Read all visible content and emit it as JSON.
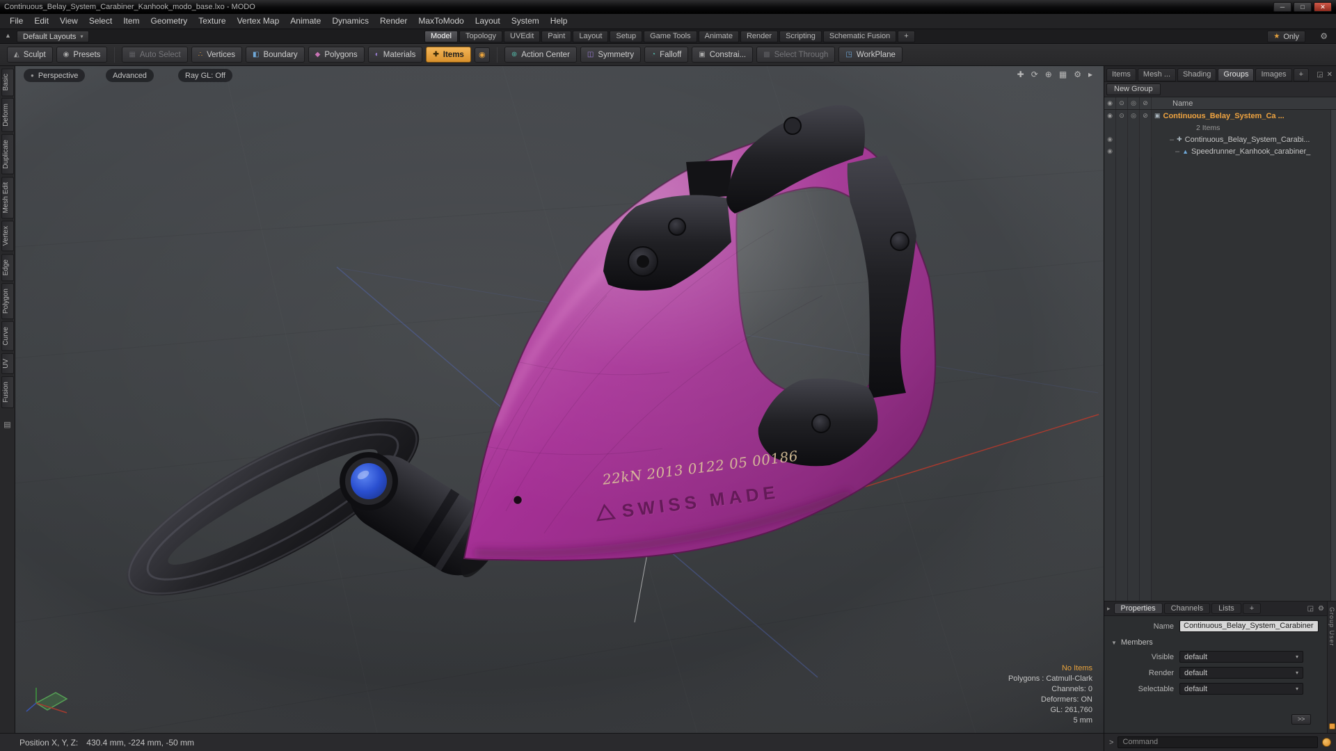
{
  "window": {
    "title": "Continuous_Belay_System_Carabiner_Kanhook_modo_base.lxo - MODO"
  },
  "icons": {
    "minimize": "─",
    "maximize": "□",
    "close": "✕",
    "layout_up": "▲",
    "dropdown": "▾",
    "star": "★",
    "gear": "⚙",
    "sculpt": "◭",
    "presets": "◉",
    "auto_select": "▦",
    "vertices": "∴",
    "boundary": "◧",
    "polygons": "◆",
    "materials": "◐",
    "items": "✚",
    "items_mode": "◉",
    "action_center": "⊕",
    "symmetry": "◫",
    "falloff": "◔",
    "constraints": "▣",
    "select_through": "▩",
    "workplane": "◳",
    "perspective": "●",
    "pan": "✚",
    "orbit": "⟳",
    "zoom": "⊕",
    "shade": "▦",
    "vp_gear": "⚙",
    "vp_arrow": "▸",
    "eye": "◉",
    "circle1": "⊙",
    "circle2": "◎",
    "circle3": "⊘",
    "group": "▣",
    "locator": "✚",
    "mesh": "▲",
    "caret_down": "▾",
    "caret_right": "▸",
    "tree_dash": "–",
    "panel_expand": "◲",
    "panel_close": "✕",
    "members_arrow": "▼",
    "palette": "▤"
  },
  "menu": {
    "items": [
      "File",
      "Edit",
      "View",
      "Select",
      "Item",
      "Geometry",
      "Texture",
      "Vertex Map",
      "Animate",
      "Dynamics",
      "Render",
      "MaxToModo",
      "Layout",
      "System",
      "Help"
    ]
  },
  "layout_bar": {
    "switcher": "Default Layouts",
    "tabs": [
      "Model",
      "Topology",
      "UVEdit",
      "Paint",
      "Layout",
      "Setup",
      "Game Tools",
      "Animate",
      "Render",
      "Scripting",
      "Schematic Fusion",
      "+"
    ],
    "only": "Only"
  },
  "toolbar": {
    "buttons": [
      {
        "label": "Sculpt"
      },
      {
        "label": "Presets"
      },
      {
        "label": "Auto Select"
      },
      {
        "label": "Vertices"
      },
      {
        "label": "Boundary"
      },
      {
        "label": "Polygons"
      },
      {
        "label": "Materials"
      },
      {
        "label": "Items"
      },
      {
        "label": "Action Center"
      },
      {
        "label": "Symmetry"
      },
      {
        "label": "Falloff"
      },
      {
        "label": "Constrai..."
      },
      {
        "label": "Select Through"
      },
      {
        "label": "WorkPlane"
      }
    ]
  },
  "left_tabs": {
    "items": [
      "Basic",
      "Deform",
      "Duplicate",
      "Mesh Edit",
      "Vertex",
      "Edge",
      "Polygon",
      "Curve",
      "UV",
      "Fusion"
    ]
  },
  "viewport": {
    "buttons": {
      "perspective": "Perspective",
      "advanced": "Advanced",
      "raygl": "Ray GL: Off"
    },
    "info": {
      "no_items": "No Items",
      "line1": "Polygons : Catmull-Clark",
      "line2": "Channels: 0",
      "line3": "Deformers: ON",
      "line4": "GL: 261,760",
      "line5": "5 mm"
    },
    "model_text": {
      "line1": "22kN 2013 0122 05 00186",
      "line2": "SWISS MADE"
    }
  },
  "right_panel": {
    "tabs": [
      "Items",
      "Mesh ...",
      "Shading",
      "Groups",
      "Images",
      "+"
    ],
    "new_group": "New Group",
    "name_header": "Name",
    "tree": [
      {
        "label": "Continuous_Belay_System_Ca ..."
      },
      {
        "label": "2 Items"
      },
      {
        "label": "Continuous_Belay_System_Carabi..."
      },
      {
        "label": "Speedrunner_Kanhook_carabiner_"
      }
    ],
    "side_tab": "Group User"
  },
  "properties": {
    "tabs": [
      "Properties",
      "Channels",
      "Lists",
      "+"
    ],
    "name_label": "Name",
    "name_value": "Continuous_Belay_System_Carabiner",
    "members": "Members",
    "visible_label": "Visible",
    "render_label": "Render",
    "selectable_label": "Selectable",
    "default_value": "default",
    "more": ">>"
  },
  "command_bar": {
    "prompt": ">",
    "placeholder": "Command"
  },
  "status_bar": {
    "label": "Position X, Y, Z:",
    "value": "430.4 mm, -224 mm, -50 mm"
  },
  "colors": {
    "accent": "#e89c3c",
    "selection": "#f0a440",
    "body_magenta": "#a53095",
    "cap_blue": "#2a4fd0"
  }
}
